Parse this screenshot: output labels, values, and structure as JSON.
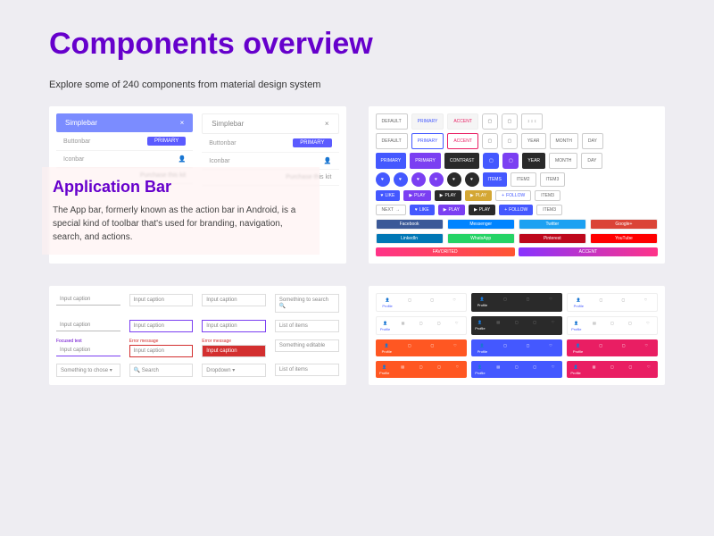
{
  "header": {
    "title": "Components overview",
    "subtitle": "Explore some of 240 components from material design system"
  },
  "appbar": {
    "brand": "Simplebar",
    "close": "×",
    "rows": {
      "buttonbar": "Buttonbar",
      "iconbar": "Iconbar",
      "primary_btn": "PRIMARY",
      "purchase": "Purchase this kit"
    },
    "overlay": {
      "title": "Application Bar",
      "text": "The App bar, formerly known as the action bar in Android, is a special kind of toolbar that's used for branding, navigation, search, and actions."
    }
  },
  "buttons": {
    "default": "DEFAULT",
    "primary": "PRIMARY",
    "accent": "ACCENT",
    "contrast": "CONTRAST",
    "year": "YEAR",
    "month": "MONTH",
    "day": "DAY",
    "items": "ITEMS",
    "item2": "ITEM2",
    "item3": "ITEM3",
    "like": "LIKE",
    "play": "PLAY",
    "follow": "FOLLOW",
    "next": "NEXT",
    "facebook": "Facebook",
    "messenger": "Messenger",
    "twitter": "Twitter",
    "google": "Google+",
    "linkedin": "LinkedIn",
    "whatsapp": "WhatsApp",
    "pinterest": "Pinterest",
    "youtube": "YouTube",
    "favorited": "FAVORITED"
  },
  "inputs": {
    "caption": "Input caption",
    "focused": "Focused text",
    "error": "Error message",
    "search": "Something to search",
    "chose": "Something to chose",
    "qsearch": "Search",
    "dropdown": "Dropdown",
    "list": "List of items",
    "editable": "Something editable"
  },
  "nav": {
    "profile": "Profile"
  }
}
